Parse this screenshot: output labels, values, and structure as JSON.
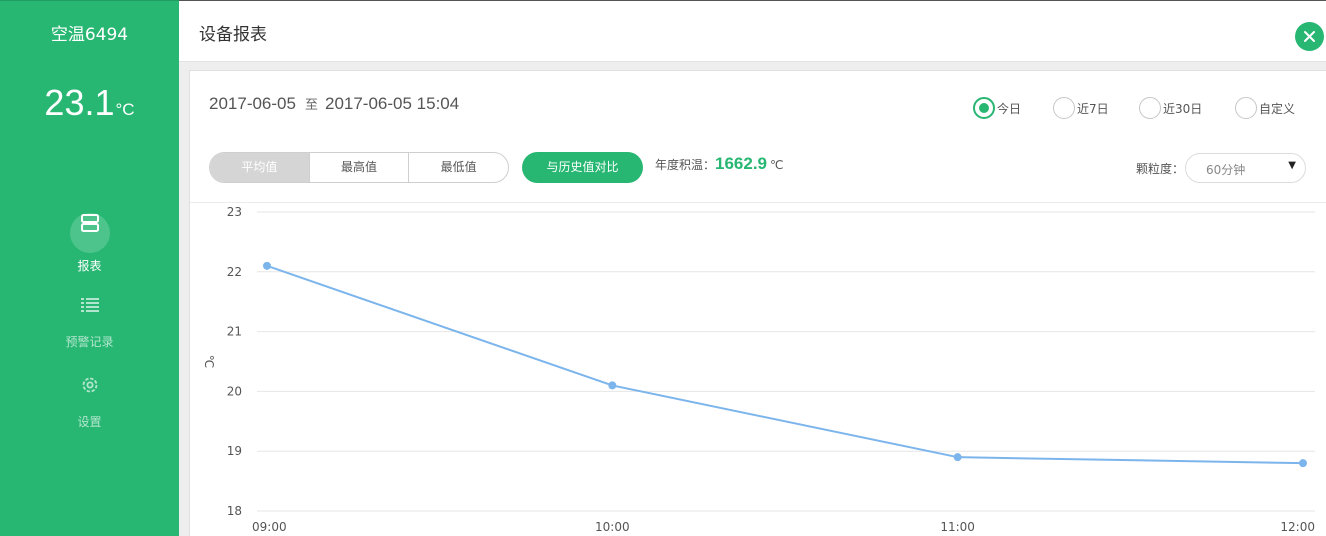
{
  "sidebar": {
    "device_name": "空温6494",
    "current_temp": "23.1",
    "temp_unit": "°C",
    "nav": {
      "report": "报表",
      "alerts": "预警记录",
      "settings": "设置"
    }
  },
  "header": {
    "title": "设备报表"
  },
  "filters": {
    "date_start": "2017-06-05",
    "date_separator": "至",
    "date_end": "2017-06-05 15:04",
    "range_options": [
      {
        "label": "今日",
        "checked": true
      },
      {
        "label": "近7日",
        "checked": false
      },
      {
        "label": "近30日",
        "checked": false
      },
      {
        "label": "自定义",
        "checked": false
      }
    ],
    "stat_buttons": [
      "平均值",
      "最高值",
      "最低值"
    ],
    "active_stat": "平均值",
    "compare_label": "与历史值对比",
    "annual_label": "年度积温：",
    "annual_value": "1662.9",
    "annual_unit": "℃",
    "granularity_label": "颗粒度：",
    "granularity_value": "60分钟",
    "granularity_caret": "▼"
  },
  "colors": {
    "brand": "#27b772",
    "line": "#7cb5ec"
  },
  "chart_data": {
    "type": "line",
    "ylabel": "℃",
    "ylim": [
      18,
      23
    ],
    "yticks": [
      23,
      22,
      21,
      20,
      19,
      18
    ],
    "categories": [
      "09:00",
      "10:00",
      "11:00",
      "12:00"
    ],
    "series": [
      {
        "values": [
          22.1,
          20.1,
          18.9,
          18.8
        ]
      }
    ],
    "grid": true
  }
}
